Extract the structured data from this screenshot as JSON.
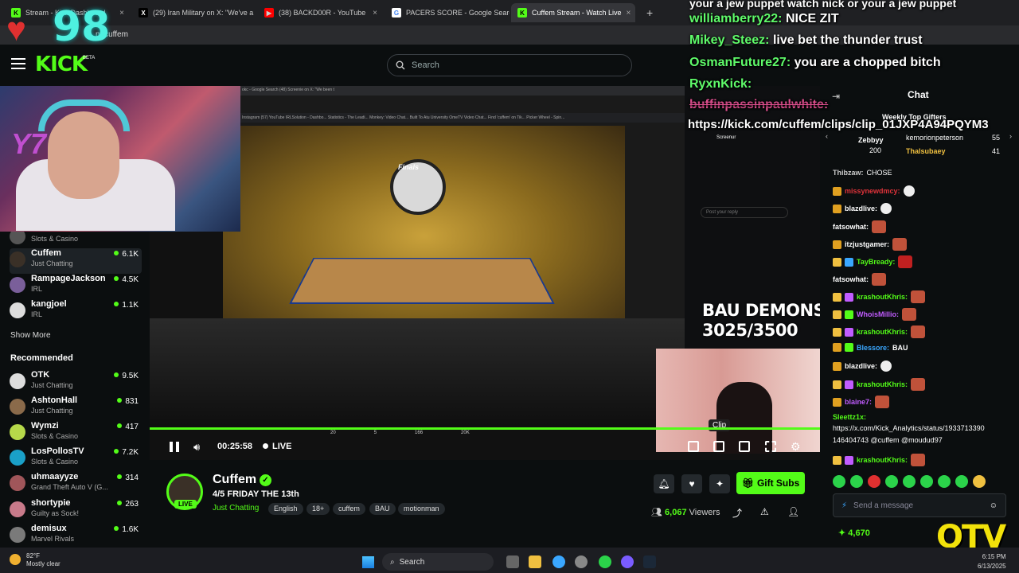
{
  "browser": {
    "tabs": [
      {
        "label": "Stream - Kick Dashboard",
        "icon": "kick-icon",
        "color": "#53fc18"
      },
      {
        "label": "(29) Iran Military on X: \"We've a",
        "icon": "x-icon",
        "color": "#000000"
      },
      {
        "label": "(38) BACKD00R - YouTube",
        "icon": "youtube-icon",
        "color": "#ff0000"
      },
      {
        "label": "PACERS SCORE - Google Search",
        "icon": "google-icon",
        "color": "#4285f4"
      },
      {
        "label": "Cuffem Stream - Watch Live",
        "icon": "kick-icon",
        "color": "#53fc18"
      }
    ],
    "url": "m/cuffem"
  },
  "overlay": {
    "heart_count": "98",
    "cam_text": "Y7",
    "bau_line1": "BAU DEMONS",
    "bau_line2": "3025/3500",
    "clip_tooltip": "Clip",
    "chat_overlay": [
      {
        "user": "",
        "text": "your a jew puppet watch nick or your a jew puppet"
      },
      {
        "user": "williamberry22:",
        "text": "NICE ZIT"
      },
      {
        "user": "Mikey_Steez:",
        "text": "live bet the thunder trust"
      },
      {
        "user": "OsmanFuture27:",
        "text": "you are a chopped bitch"
      },
      {
        "user": "RyxnKick:",
        "text": ""
      },
      {
        "user": "buffinpassinpaulwhite:",
        "text": ""
      },
      {
        "user": "",
        "text": "https://kick.com/cuffem/clips/clip_01JXP4A94PQYM3"
      }
    ]
  },
  "header": {
    "logo": "KICK",
    "beta": "BETA",
    "search_placeholder": "Search"
  },
  "sidebar": {
    "following": [
      {
        "name": "",
        "category": "Slots & Casino",
        "viewers": ""
      },
      {
        "name": "Cuffem",
        "category": "Just Chatting",
        "viewers": "6.1K"
      },
      {
        "name": "RampageJackson",
        "category": "IRL",
        "viewers": "4.5K"
      },
      {
        "name": "kangjoel",
        "category": "IRL",
        "viewers": "1.1K"
      }
    ],
    "show_more": "Show More",
    "recommended_label": "Recommended",
    "recommended": [
      {
        "name": "OTK",
        "category": "Just Chatting",
        "viewers": "9.5K"
      },
      {
        "name": "AshtonHall",
        "category": "Just Chatting",
        "viewers": "831"
      },
      {
        "name": "Wymzi",
        "category": "Slots & Casino",
        "viewers": "417"
      },
      {
        "name": "LosPollosTV",
        "category": "Slots & Casino",
        "viewers": "7.2K"
      },
      {
        "name": "uhmaayyze",
        "category": "Grand Theft Auto V (G...",
        "viewers": "314"
      },
      {
        "name": "shortypie",
        "category": "Guilty as Sock!",
        "viewers": "263"
      },
      {
        "name": "demisux",
        "category": "Marvel Rivals",
        "viewers": "1.6K"
      }
    ]
  },
  "player": {
    "screen_tab1": "okc - Google Search",
    "screen_tab2": "(48) Screenie on X: \"We been t",
    "screen_bookmarks": "Instagram  (57) YouTube  IRLSolution - Dashbo...  Statistics - The Leadi...  Monkey: Video Chat...  Built To Atu University  OmeTV Video Chat...  Find 'cuffem' on Tik...  Picker Wheel - Spin...",
    "finals": "Finals",
    "time": "00:25:58",
    "live": "LIVE",
    "tweet_counts": [
      "20",
      "5",
      "166",
      "20K"
    ]
  },
  "stream": {
    "name": "Cuffem",
    "title": "4/5 FRIDAY THE 13th",
    "category": "Just Chatting",
    "tags": [
      "English",
      "18+",
      "cuffem",
      "BAU",
      "motionman"
    ],
    "live_badge": "LIVE",
    "gift_label": "Gift Subs",
    "viewers": "6,067",
    "viewers_label": "Viewers"
  },
  "chat": {
    "title": "Chat",
    "gifters_label": "Weekly Top Gifters",
    "gifters": [
      {
        "name": "Zebbyy",
        "amount": "200"
      },
      {
        "name": "kemorionpeterson",
        "amount": "55"
      },
      {
        "name": "Thalsubaey",
        "amount": "41"
      }
    ],
    "messages": [
      {
        "user": "Thibzaw:",
        "text": "CHOSE",
        "color": "#cccccc"
      },
      {
        "user": "missynewdmcy:",
        "text": "",
        "color": "#e0333a"
      },
      {
        "user": "blazdlive:",
        "text": "",
        "color": "#ffffff"
      },
      {
        "user": "fatsowhat:",
        "text": "",
        "color": "#ffffff"
      },
      {
        "user": "itzjustgamer:",
        "text": "",
        "color": "#ffffff"
      },
      {
        "user": "TayBready:",
        "text": "",
        "color": "#53fc18"
      },
      {
        "user": "fatsowhat:",
        "text": "",
        "color": "#ffffff"
      },
      {
        "user": "krashoutKhris:",
        "text": "",
        "color": "#53fc18"
      },
      {
        "user": "WhoisMillio:",
        "text": "",
        "color": "#c15cff"
      },
      {
        "user": "krashoutKhris:",
        "text": "",
        "color": "#53fc18"
      },
      {
        "user": "Blessore:",
        "text": "BAU",
        "color": "#3aa7ff"
      },
      {
        "user": "blazdlive:",
        "text": "",
        "color": "#ffffff"
      },
      {
        "user": "krashoutKhris:",
        "text": "",
        "color": "#53fc18"
      },
      {
        "user": "blaine7:",
        "text": "",
        "color": "#c15cff"
      }
    ],
    "link_user": "Sleettz1x:",
    "link_text": "https://x.com/Kick_Analytics/status/1933713390",
    "link_text2": "146404743 @cuffem @moudud97",
    "last_user": "krashoutKhris:",
    "send_placeholder": "Send a message",
    "points": "4,670",
    "qtv": "QTV"
  },
  "taskbar": {
    "temp": "82°F",
    "weather": "Mostly clear",
    "search": "Search",
    "time": "6:15 PM",
    "date": "6/13/2025"
  }
}
